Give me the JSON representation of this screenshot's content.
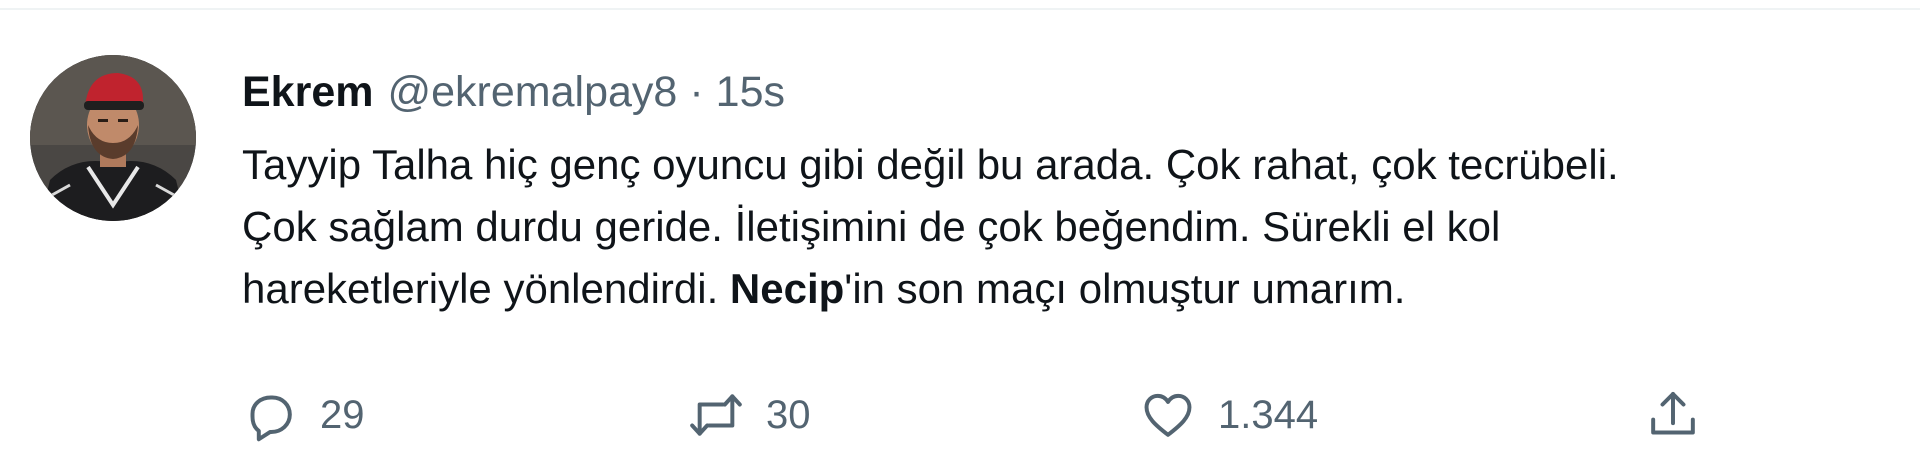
{
  "tweet": {
    "author": {
      "name": "Ekrem",
      "handle": "@ekremalpay8",
      "avatar_icon": "user-avatar-photo"
    },
    "separator": "·",
    "time": "15s",
    "body": {
      "line1": "Tayyip Talha hiç genç oyuncu gibi değil bu arada. Çok rahat, çok tecrübeli.",
      "line2": "Çok sağlam durdu geride. İletişimini de çok beğendim. Sürekli el kol",
      "line3_start": "hareketleriyle yönlendirdi. ",
      "line3_bold": "Necip",
      "line3_end": "'in son maçı olmuştur umarım."
    },
    "actions": {
      "reply": {
        "icon": "reply-icon",
        "count": "29"
      },
      "retweet": {
        "icon": "retweet-icon",
        "count": "30"
      },
      "like": {
        "icon": "heart-icon",
        "count": "1.344"
      },
      "share": {
        "icon": "share-icon"
      }
    },
    "colors": {
      "text_primary": "#0f1419",
      "text_secondary": "#536471",
      "divider": "#eff3f4"
    }
  }
}
